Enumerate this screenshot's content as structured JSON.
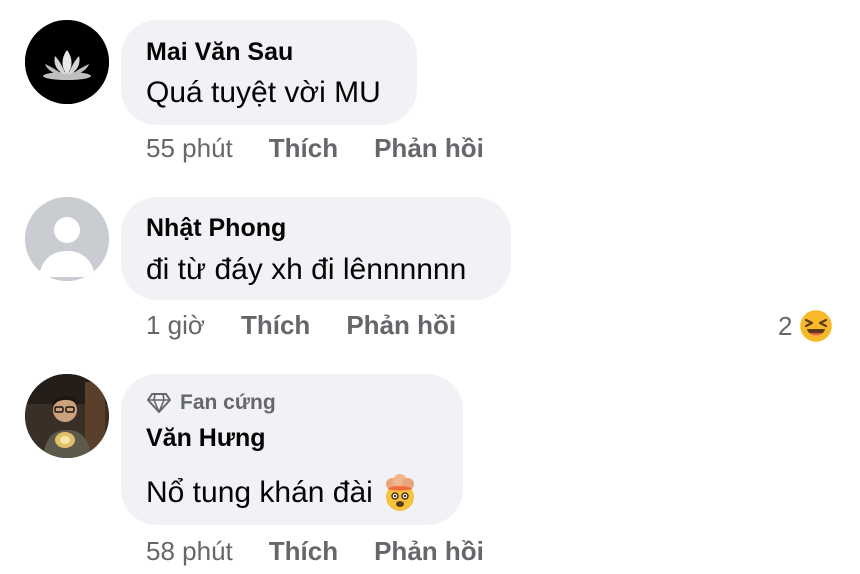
{
  "comments": [
    {
      "author": "Mai Văn Sau",
      "text": "Quá tuyệt vời MU",
      "time": "55 phút",
      "like_label": "Thích",
      "reply_label": "Phản hồi",
      "avatar_icon": "lotus-avatar"
    },
    {
      "author": "Nhật Phong",
      "text": "đi từ đáy xh đi lênnnnnn",
      "time": "1 giờ",
      "like_label": "Thích",
      "reply_label": "Phản hồi",
      "avatar_icon": "default-person-avatar",
      "reaction_count": "2",
      "reaction_icon": "laughing-emoji-icon"
    },
    {
      "badge": "Fan cứng",
      "badge_icon": "diamond-icon",
      "author": "Văn Hưng",
      "text": "Nổ tung khán đài",
      "text_emoji": "exploding-head-emoji-icon",
      "time": "58 phút",
      "like_label": "Thích",
      "reply_label": "Phản hồi",
      "avatar_icon": "illustrated-person-avatar"
    }
  ],
  "colors": {
    "bubble": "#f0f2f5",
    "meta": "#65676b",
    "text": "#050505"
  }
}
